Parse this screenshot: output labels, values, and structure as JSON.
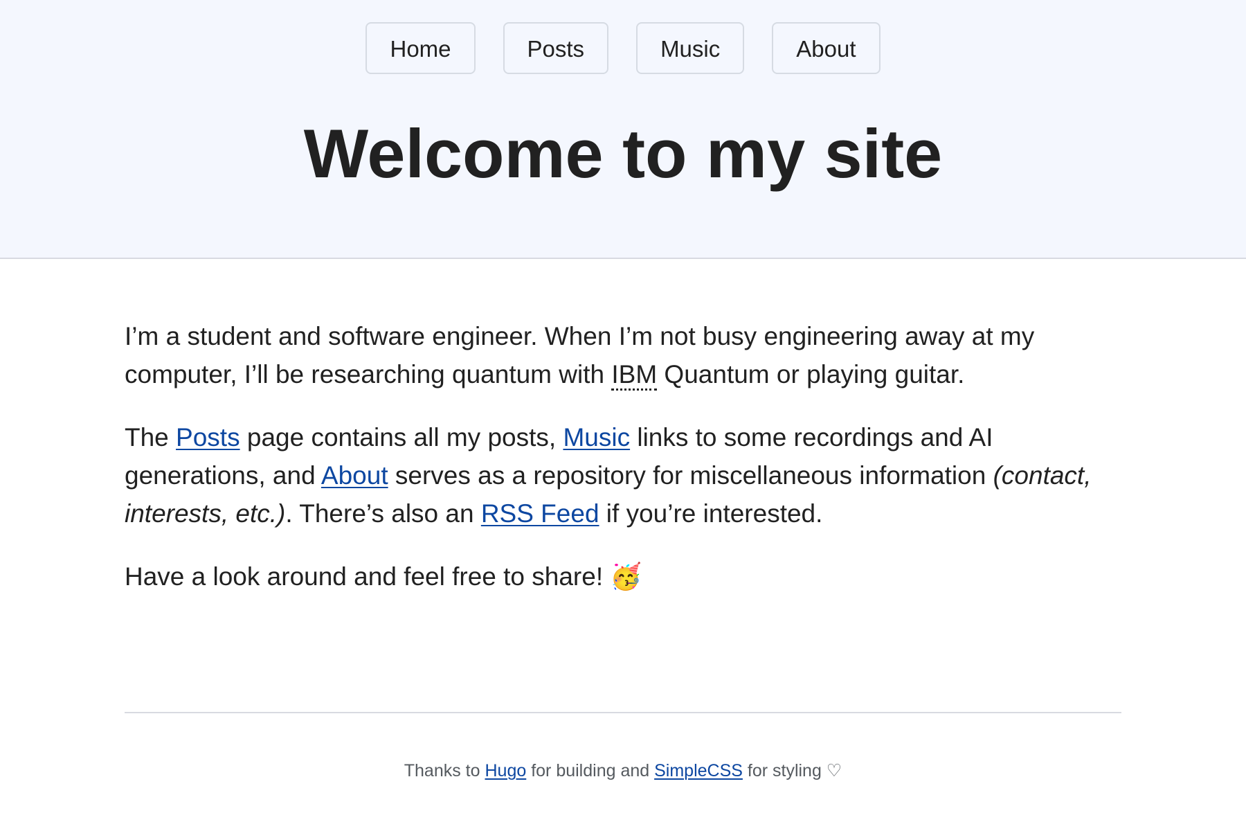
{
  "nav": {
    "items": [
      {
        "label": "Home"
      },
      {
        "label": "Posts"
      },
      {
        "label": "Music"
      },
      {
        "label": "About"
      }
    ]
  },
  "header": {
    "title": "Welcome to my site"
  },
  "intro": {
    "p1_before": "I’m a student and software engineer. When I’m not busy engineering away at my computer, I’ll be researching quantum with ",
    "p1_abbr": "IBM",
    "p1_after": " Quantum or playing guitar.",
    "p2_text1": "The ",
    "p2_link_posts": "Posts",
    "p2_text2": " page contains all my posts, ",
    "p2_link_music": "Music",
    "p2_text3": " links to some recordings and AI generations, and ",
    "p2_link_about": "About",
    "p2_text4": " serves as a repository for miscellaneous information ",
    "p2_em": "(contact, interests, etc.)",
    "p2_text5": ". There’s also an ",
    "p2_link_rss": "RSS Feed",
    "p2_text6": " if you’re interested.",
    "p3_text": "Have a look around and feel free to share! ",
    "p3_emoji": "🥳"
  },
  "footer": {
    "text1": "Thanks to ",
    "link_hugo": "Hugo",
    "text2": " for building and ",
    "link_simplecss": "SimpleCSS",
    "text3": " for styling ♡"
  },
  "colors": {
    "header_bg": "#f4f7fe",
    "link": "#0d47a1",
    "text": "#212121",
    "footer_text": "#555a5f"
  }
}
